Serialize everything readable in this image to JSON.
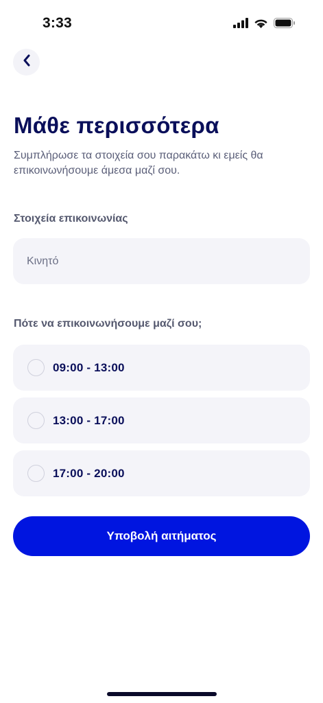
{
  "status_bar": {
    "time": "3:33",
    "icons": [
      "cellular-signal-icon",
      "wifi-icon",
      "battery-icon"
    ]
  },
  "header": {
    "back_icon": "chevron-left-icon"
  },
  "content": {
    "title": "Μάθε περισσότερα",
    "subtitle": "Συμπλήρωσε τα στοιχεία σου παρακάτω κι εμείς θα επικοινωνήσουμε άμεσα μαζί σου.",
    "contact_section_label": "Στοιχεία επικοινωνίας",
    "phone_input": {
      "value": "",
      "placeholder": "Κινητό"
    },
    "time_section_label": "Πότε να επικοινωνήσουμε μαζί σου;",
    "time_options": [
      {
        "label": "09:00 - 13:00",
        "selected": false
      },
      {
        "label": "13:00 - 17:00",
        "selected": false
      },
      {
        "label": "17:00 - 20:00",
        "selected": false
      }
    ],
    "submit_label": "Υποβολή αιτήματος"
  },
  "colors": {
    "primary": "#0015e0",
    "heading": "#0a0f5a",
    "field_background": "#f4f4f9",
    "muted_text": "#5a5e78"
  }
}
